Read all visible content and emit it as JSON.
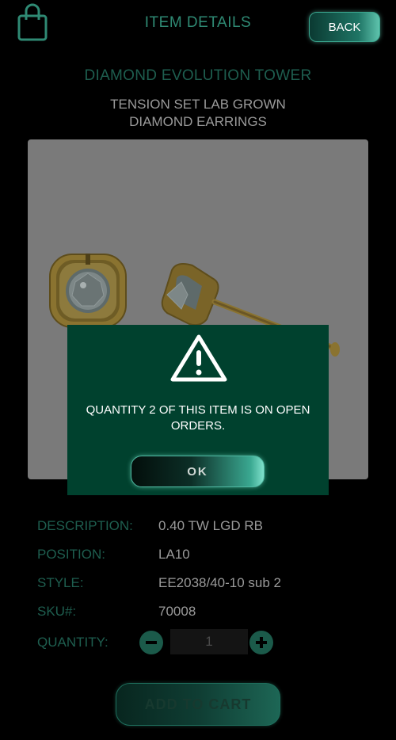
{
  "header": {
    "title": "ITEM DETAILS",
    "back_label": "BACK",
    "bag_icon": "shopping-bag-icon"
  },
  "product": {
    "collection": "DIAMOND EVOLUTION TOWER",
    "name_line1": "TENSION SET LAB GROWN",
    "name_line2": "DIAMOND EARRINGS"
  },
  "details": {
    "description_label": "DESCRIPTION:",
    "description_value": "0.40 TW LGD RB",
    "position_label": "POSITION:",
    "position_value": "LA10",
    "style_label": "STYLE:",
    "style_value": "EE2038/40-10 sub 2",
    "sku_label": "SKU#:",
    "sku_value": "70008",
    "quantity_label": "QUANTITY:",
    "quantity_value": "1"
  },
  "add_to_cart_label": "ADD TO CART",
  "modal": {
    "icon": "warning-icon",
    "message": "QUANTITY 2 OF THIS ITEM IS ON OPEN ORDERS.",
    "ok_label": "OK"
  },
  "colors": {
    "accent": "#2f8a74",
    "modal_bg": "#00412e",
    "background": "#000000"
  }
}
